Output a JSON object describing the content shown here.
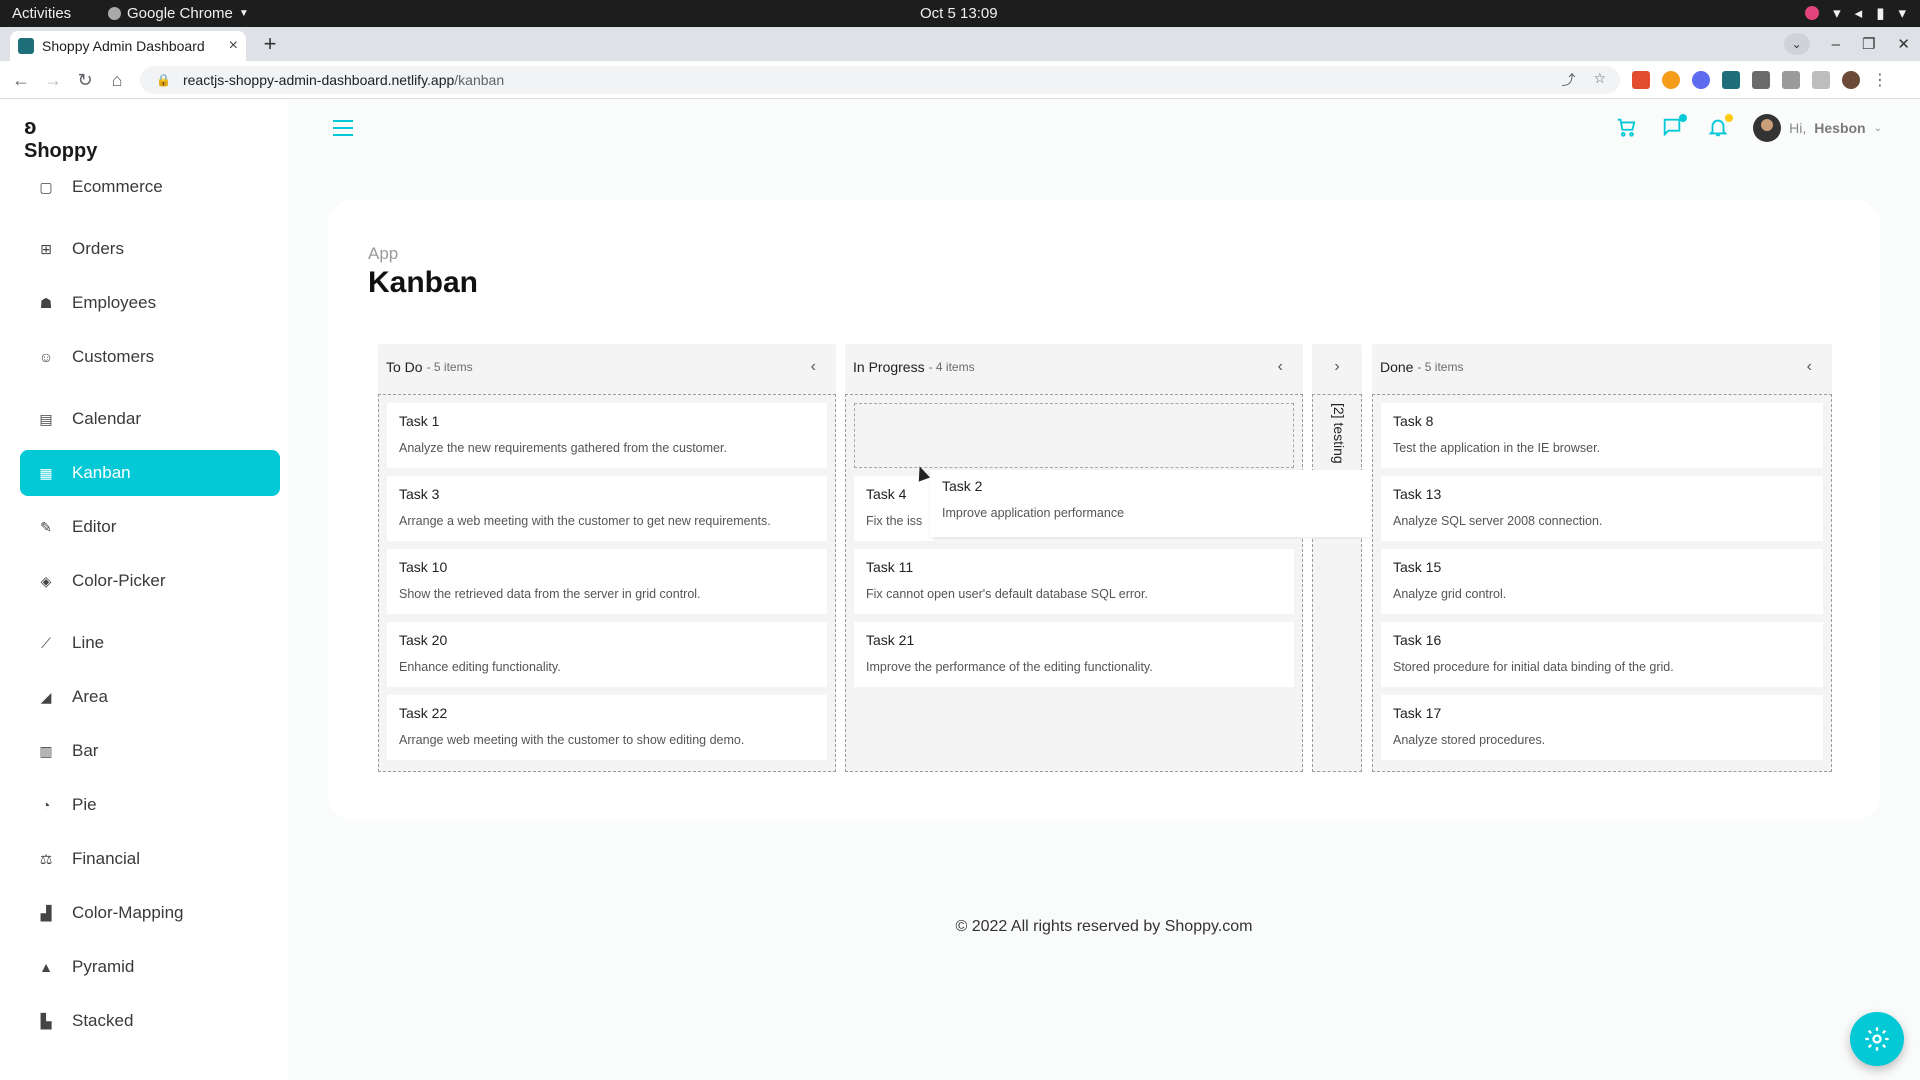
{
  "system_bar": {
    "activities": "Activities",
    "app_name": "Google Chrome",
    "clock": "Oct 5  13:09"
  },
  "browser": {
    "tab_title": "Shoppy Admin Dashboard",
    "url_host": "reactjs-shoppy-admin-dashboard.netlify.app",
    "url_path": "/kanban"
  },
  "sidebar": {
    "logo": "Shoppy",
    "items": [
      {
        "label": "Ecommerce",
        "icon": "bag-icon"
      },
      {
        "label": "Orders",
        "icon": "cart-icon"
      },
      {
        "label": "Employees",
        "icon": "people-icon"
      },
      {
        "label": "Customers",
        "icon": "user-icon"
      },
      {
        "label": "Calendar",
        "icon": "calendar-icon"
      },
      {
        "label": "Kanban",
        "icon": "kanban-icon"
      },
      {
        "label": "Editor",
        "icon": "edit-icon"
      },
      {
        "label": "Color-Picker",
        "icon": "color-picker-icon"
      },
      {
        "label": "Line",
        "icon": "line-chart-icon"
      },
      {
        "label": "Area",
        "icon": "area-chart-icon"
      },
      {
        "label": "Bar",
        "icon": "bar-chart-icon"
      },
      {
        "label": "Pie",
        "icon": "pie-chart-icon"
      },
      {
        "label": "Financial",
        "icon": "financial-icon"
      },
      {
        "label": "Color-Mapping",
        "icon": "color-mapping-icon"
      },
      {
        "label": "Pyramid",
        "icon": "pyramid-icon"
      },
      {
        "label": "Stacked",
        "icon": "stacked-icon"
      }
    ],
    "active": "Kanban"
  },
  "header": {
    "greeting": "Hi,",
    "username": "Hesbon",
    "accent": "#03c9d7"
  },
  "page": {
    "breadcrumb": "App",
    "title": "Kanban"
  },
  "kanban": {
    "columns": [
      {
        "name": "To Do",
        "count": "- 5 items",
        "cards": [
          {
            "title": "Task 1",
            "desc": "Analyze the new requirements gathered from the customer."
          },
          {
            "title": "Task 3",
            "desc": "Arrange a web meeting with the customer to get new requirements."
          },
          {
            "title": "Task 10",
            "desc": "Show the retrieved data from the server in grid control."
          },
          {
            "title": "Task 20",
            "desc": "Enhance editing functionality."
          },
          {
            "title": "Task 22",
            "desc": "Arrange web meeting with the customer to show editing demo."
          }
        ]
      },
      {
        "name": "In Progress",
        "count": "- 4 items",
        "cards": [
          {
            "title": "Task 4",
            "desc": "Fix the iss"
          },
          {
            "title": "Task 11",
            "desc": "Fix cannot open user's default database SQL error."
          },
          {
            "title": "Task 21",
            "desc": "Improve the performance of the editing functionality."
          }
        ]
      },
      {
        "name": "testing",
        "collapsed_label": "[2] testing"
      },
      {
        "name": "Done",
        "count": "- 5 items",
        "cards": [
          {
            "title": "Task 8",
            "desc": "Test the application in the IE browser."
          },
          {
            "title": "Task 13",
            "desc": "Analyze SQL server 2008 connection."
          },
          {
            "title": "Task 15",
            "desc": "Analyze grid control."
          },
          {
            "title": "Task 16",
            "desc": "Stored procedure for initial data binding of the grid."
          },
          {
            "title": "Task 17",
            "desc": "Analyze stored procedures."
          }
        ]
      }
    ],
    "dragging": {
      "title": "Task 2",
      "desc": "Improve application performance"
    }
  },
  "footer": "© 2022 All rights reserved by Shoppy.com"
}
